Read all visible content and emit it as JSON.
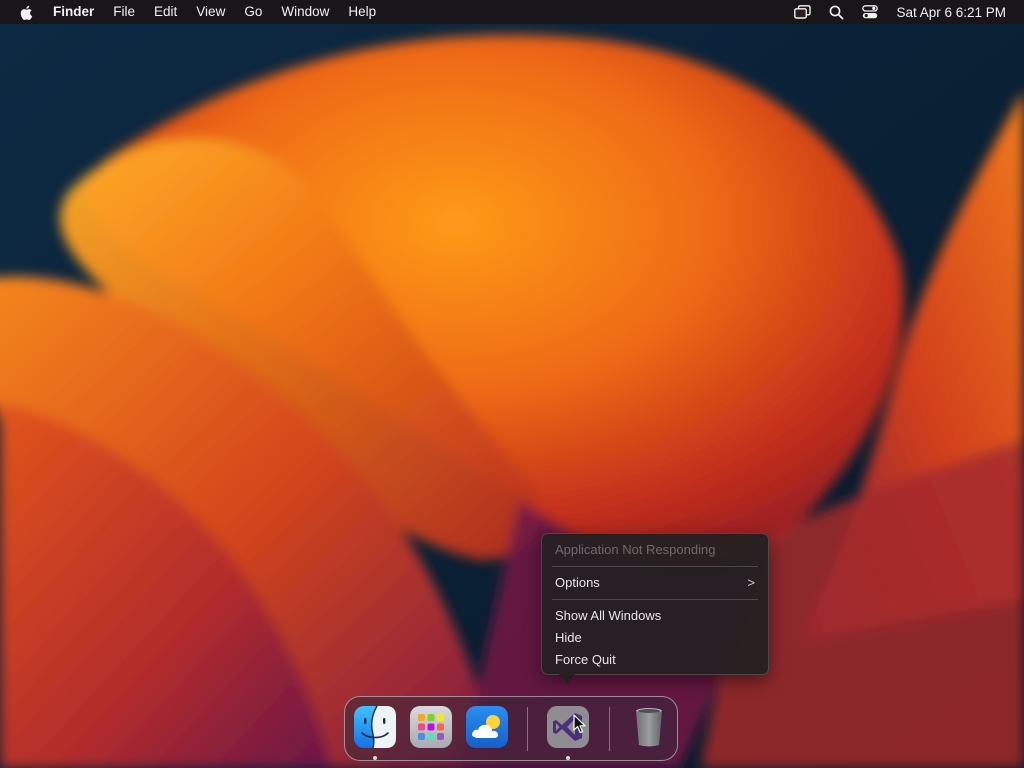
{
  "menubar": {
    "apple_icon": "apple-logo-icon",
    "app_name": "Finder",
    "menus": [
      "File",
      "Edit",
      "View",
      "Go",
      "Window",
      "Help"
    ],
    "status_icons": [
      "screen-mirroring-icon",
      "spotlight-search-icon",
      "control-center-icon"
    ],
    "clock": "Sat Apr 6  6:21 PM"
  },
  "context_menu": {
    "title": "Application Not Responding",
    "options_label": "Options",
    "options_chevron": ">",
    "items": [
      "Show All Windows",
      "Hide",
      "Force Quit"
    ]
  },
  "dock": {
    "apps": [
      {
        "name": "Finder",
        "icon": "finder-icon",
        "running": true
      },
      {
        "name": "Launchpad",
        "icon": "launchpad-icon",
        "running": false
      },
      {
        "name": "Weather",
        "icon": "weather-icon",
        "running": false
      },
      {
        "name": "Visual Studio",
        "icon": "visual-studio-icon",
        "running": true
      },
      {
        "name": "Trash",
        "icon": "trash-icon",
        "running": false
      }
    ]
  },
  "colors": {
    "wallpaper_orange": "#f28a12",
    "wallpaper_red": "#c3301d",
    "wallpaper_magenta": "#7a1a4e",
    "wallpaper_navy": "#0b2036",
    "menubar": "#1c1414"
  }
}
